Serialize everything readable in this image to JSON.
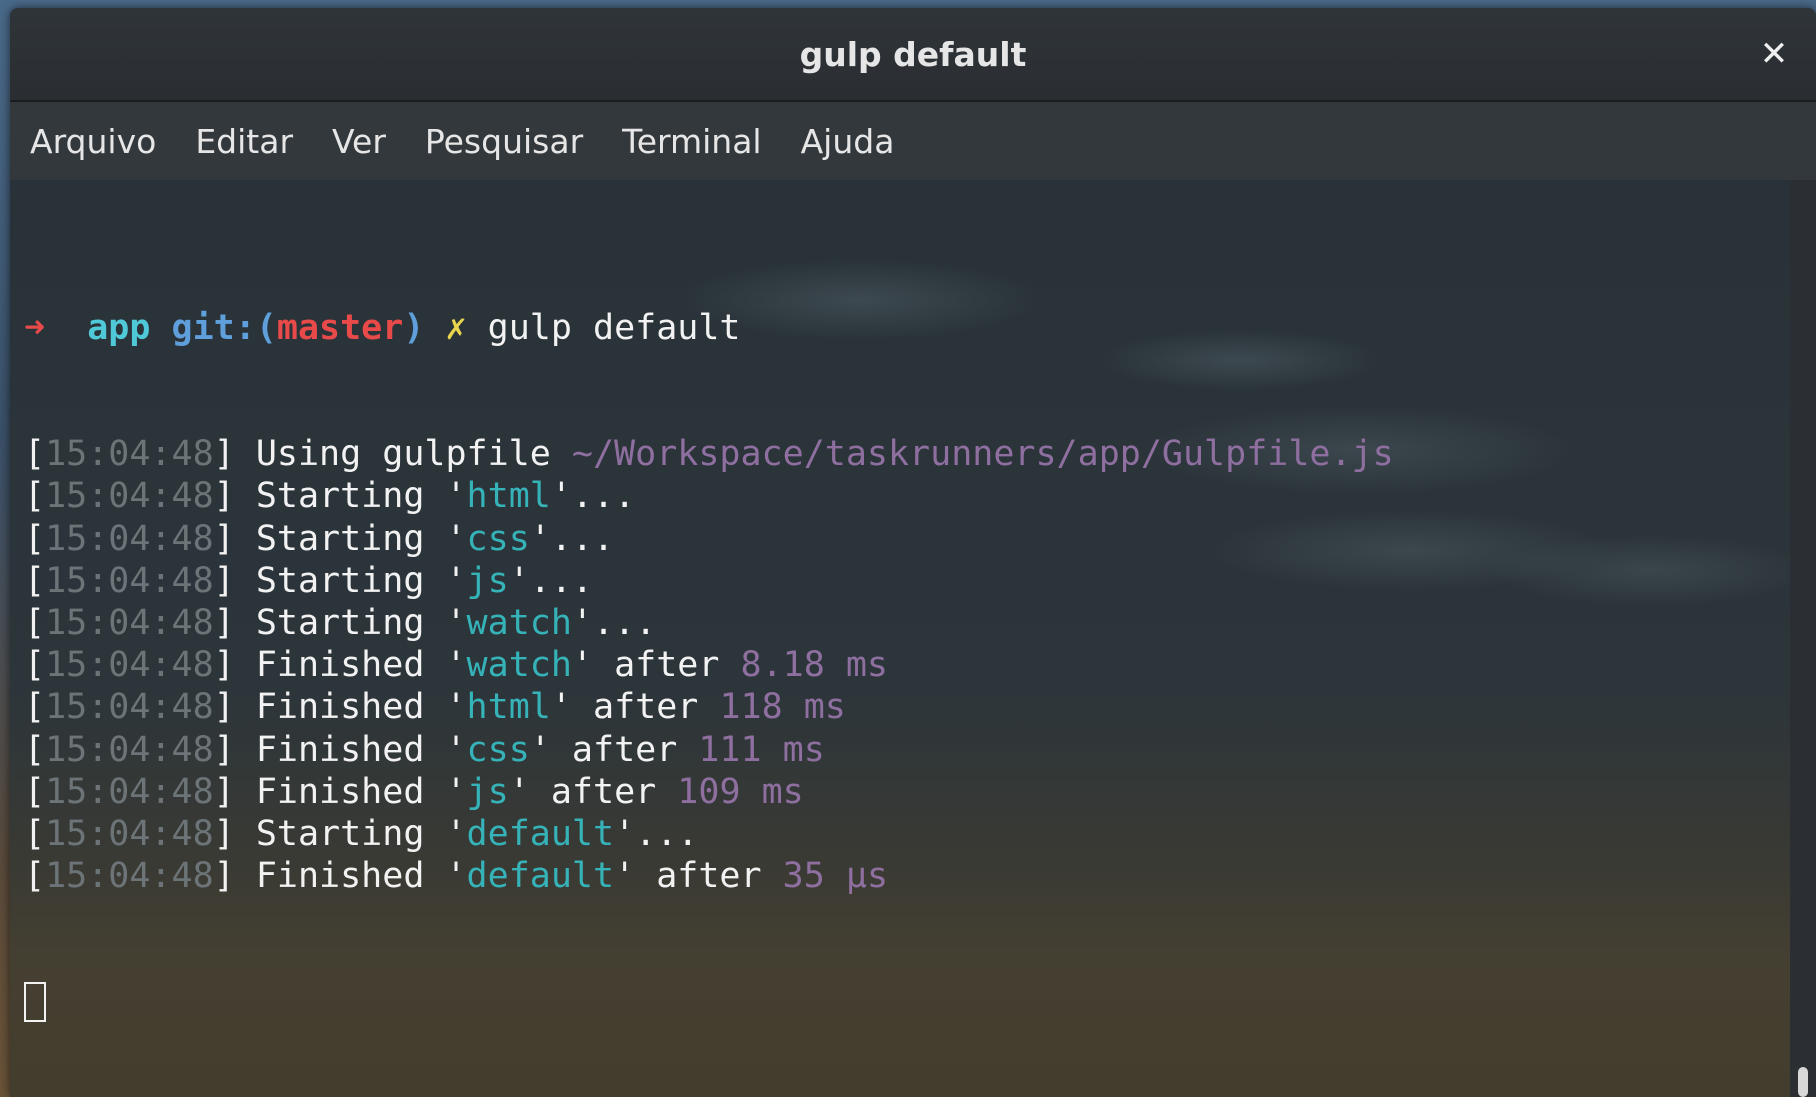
{
  "window": {
    "title": "gulp default",
    "close_icon": "close-icon"
  },
  "menu": {
    "items": [
      "Arquivo",
      "Editar",
      "Ver",
      "Pesquisar",
      "Terminal",
      "Ajuda"
    ]
  },
  "terminal": {
    "prompt": {
      "arrow": "➜",
      "cwd": "app",
      "git_prefix": "git:(",
      "branch": "master",
      "git_suffix": ")",
      "dirty_mark": "✗",
      "command": "gulp default"
    },
    "log_lines": [
      {
        "time": "15:04:48",
        "verb": "Using gulpfile",
        "path": "~/Workspace/taskrunners/app/Gulpfile.js"
      },
      {
        "time": "15:04:48",
        "verb": "Starting",
        "task": "html",
        "suffix": "..."
      },
      {
        "time": "15:04:48",
        "verb": "Starting",
        "task": "css",
        "suffix": "..."
      },
      {
        "time": "15:04:48",
        "verb": "Starting",
        "task": "js",
        "suffix": "..."
      },
      {
        "time": "15:04:48",
        "verb": "Starting",
        "task": "watch",
        "suffix": "..."
      },
      {
        "time": "15:04:48",
        "verb": "Finished",
        "task": "watch",
        "after": "after",
        "duration": "8.18 ms"
      },
      {
        "time": "15:04:48",
        "verb": "Finished",
        "task": "html",
        "after": "after",
        "duration": "118 ms"
      },
      {
        "time": "15:04:48",
        "verb": "Finished",
        "task": "css",
        "after": "after",
        "duration": "111 ms"
      },
      {
        "time": "15:04:48",
        "verb": "Finished",
        "task": "js",
        "after": "after",
        "duration": "109 ms"
      },
      {
        "time": "15:04:48",
        "verb": "Starting",
        "task": "default",
        "suffix": "..."
      },
      {
        "time": "15:04:48",
        "verb": "Finished",
        "task": "default",
        "after": "after",
        "duration": "35 μs"
      }
    ]
  },
  "colors": {
    "prompt_arrow": "#e84a4a",
    "cwd": "#4fc8d8",
    "git": "#5f9fdc",
    "branch": "#e84a4a",
    "dirty": "#e8d44d",
    "timestamp": "#6c7478",
    "task_name": "#35b3b8",
    "path_and_duration": "#8e6fa0"
  }
}
